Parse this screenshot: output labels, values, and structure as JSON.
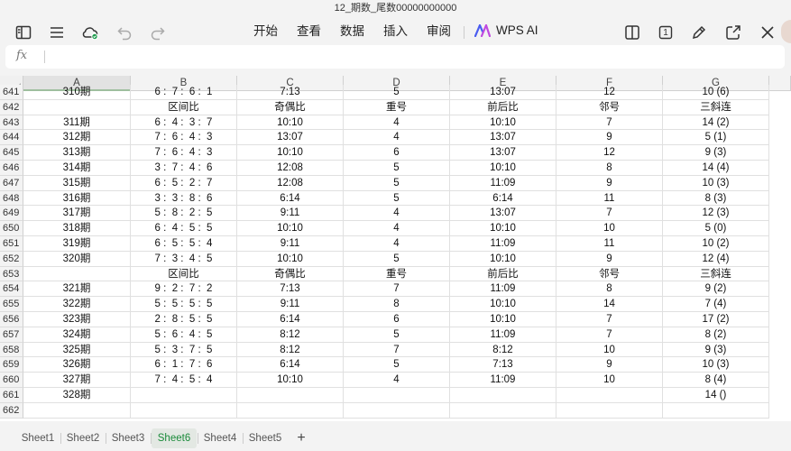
{
  "window": {
    "title": "12_期数_尾数00000000000"
  },
  "toolbar": {
    "menu": [
      "开始",
      "查看",
      "数据",
      "插入",
      "审阅"
    ],
    "wps_ai": "WPS AI",
    "page_count": "1"
  },
  "formula_bar": {
    "fx_label": "fx",
    "value": ""
  },
  "columns": [
    "A",
    "B",
    "C",
    "D",
    "E",
    "F",
    "G"
  ],
  "selected_column": "A",
  "rows": [
    {
      "n": "641",
      "cells": [
        "310期",
        "6 :  7 :  6 :  1",
        "7:13",
        "5",
        "13:07",
        "12",
        "10 (6)"
      ]
    },
    {
      "n": "642",
      "cells": [
        "",
        "区间比",
        "奇偶比",
        "重号",
        "前后比",
        "邻号",
        "三斜连"
      ]
    },
    {
      "n": "643",
      "cells": [
        "311期",
        "6 :  4 :  3 :  7",
        "10:10",
        "4",
        "10:10",
        "7",
        "14 (2)"
      ]
    },
    {
      "n": "644",
      "cells": [
        "312期",
        "7 :  6 :  4 :  3",
        "13:07",
        "4",
        "13:07",
        "9",
        "5 (1)"
      ]
    },
    {
      "n": "645",
      "cells": [
        "313期",
        "7 :  6 :  4 :  3",
        "10:10",
        "6",
        "13:07",
        "12",
        "9 (3)"
      ]
    },
    {
      "n": "646",
      "cells": [
        "314期",
        "3 :  7 :  4 :  6",
        "12:08",
        "5",
        "10:10",
        "8",
        "14 (4)"
      ]
    },
    {
      "n": "647",
      "cells": [
        "315期",
        "6 :  5 :  2 :  7",
        "12:08",
        "5",
        "11:09",
        "9",
        "10 (3)"
      ]
    },
    {
      "n": "648",
      "cells": [
        "316期",
        "3 :  3 :  8 :  6",
        "6:14",
        "5",
        "6:14",
        "11",
        "8 (3)"
      ]
    },
    {
      "n": "649",
      "cells": [
        "317期",
        "5 :  8 :  2 :  5",
        "9:11",
        "4",
        "13:07",
        "7",
        "12 (3)"
      ]
    },
    {
      "n": "650",
      "cells": [
        "318期",
        "6 :  4 :  5 :  5",
        "10:10",
        "4",
        "10:10",
        "10",
        "5 (0)"
      ]
    },
    {
      "n": "651",
      "cells": [
        "319期",
        "6 :  5 :  5 :  4",
        "9:11",
        "4",
        "11:09",
        "11",
        "10 (2)"
      ]
    },
    {
      "n": "652",
      "cells": [
        "320期",
        "7 :  3 :  4 :  5",
        "10:10",
        "5",
        "10:10",
        "9",
        "12 (4)"
      ]
    },
    {
      "n": "653",
      "cells": [
        "",
        "区间比",
        "奇偶比",
        "重号",
        "前后比",
        "邻号",
        "三斜连"
      ]
    },
    {
      "n": "654",
      "cells": [
        "321期",
        "9 :  2 :  7 :  2",
        "7:13",
        "7",
        "11:09",
        "8",
        "9 (2)"
      ]
    },
    {
      "n": "655",
      "cells": [
        "322期",
        "5 :  5 :  5 :  5",
        "9:11",
        "8",
        "10:10",
        "14",
        "7 (4)"
      ]
    },
    {
      "n": "656",
      "cells": [
        "323期",
        "2 :  8 :  5 :  5",
        "6:14",
        "6",
        "10:10",
        "7",
        "17 (2)"
      ]
    },
    {
      "n": "657",
      "cells": [
        "324期",
        "5 :  6 :  4 :  5",
        "8:12",
        "5",
        "11:09",
        "7",
        "8 (2)"
      ]
    },
    {
      "n": "658",
      "cells": [
        "325期",
        "5 :  3 :  7 :  5",
        "8:12",
        "7",
        "8:12",
        "10",
        "9 (3)"
      ]
    },
    {
      "n": "659",
      "cells": [
        "326期",
        "6 :  1 :  7 :  6",
        "6:14",
        "5",
        "7:13",
        "9",
        "10 (3)"
      ]
    },
    {
      "n": "660",
      "cells": [
        "327期",
        "7 :  4 :  5 :  4",
        "10:10",
        "4",
        "11:09",
        "10",
        "8 (4)"
      ]
    },
    {
      "n": "661",
      "cells": [
        "328期",
        "",
        "",
        "",
        "",
        "",
        "14 ()"
      ]
    },
    {
      "n": "662",
      "cells": [
        "",
        "",
        "",
        "",
        "",
        "",
        ""
      ]
    }
  ],
  "sheets": [
    "Sheet1",
    "Sheet2",
    "Sheet3",
    "Sheet6",
    "Sheet4",
    "Sheet5"
  ],
  "active_sheet": "Sheet6",
  "add_sheet_label": "+"
}
